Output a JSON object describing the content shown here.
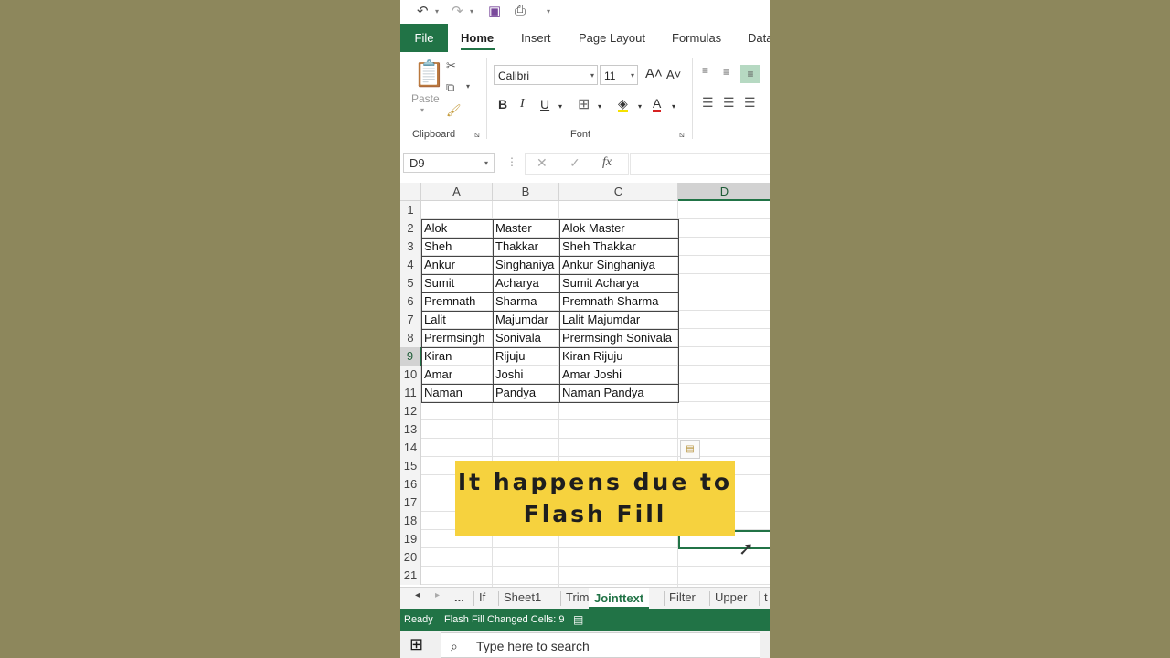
{
  "qat": {
    "more": "▾"
  },
  "tabs": {
    "file": "File",
    "home": "Home",
    "insert": "Insert",
    "page_layout": "Page Layout",
    "formulas": "Formulas",
    "data": "Data"
  },
  "ribbon": {
    "clipboard_label": "Clipboard",
    "paste_label": "Paste",
    "font_label": "Font",
    "font_name": "Calibri",
    "font_size": "11",
    "bold": "B",
    "italic": "I",
    "underline": "U"
  },
  "formula_bar": {
    "name_box": "D9",
    "fx": "fx",
    "formula": ""
  },
  "grid": {
    "columns": [
      "A",
      "B",
      "C",
      "D"
    ],
    "selected_column": "D",
    "row_numbers": [
      "1",
      "2",
      "3",
      "4",
      "5",
      "6",
      "7",
      "8",
      "9",
      "10",
      "11",
      "12",
      "13",
      "14",
      "15",
      "16",
      "17",
      "18",
      "19",
      "20",
      "21"
    ],
    "selected_row": "9",
    "rows": [
      [
        "Alok",
        "Master",
        "Alok Master"
      ],
      [
        "Sheh",
        "Thakkar",
        "Sheh Thakkar"
      ],
      [
        "Ankur",
        "Singhaniya",
        "Ankur Singhaniya"
      ],
      [
        "Sumit",
        "Acharya",
        "Sumit Acharya"
      ],
      [
        "Premnath",
        "Sharma",
        "Premnath Sharma"
      ],
      [
        "Lalit",
        "Majumdar",
        "Lalit Majumdar"
      ],
      [
        "Prermsingh",
        "Sonivala",
        "Prermsingh Sonivala"
      ],
      [
        "Kiran",
        "Rijuju",
        "Kiran Rijuju"
      ],
      [
        "Amar",
        "Joshi",
        "Amar Joshi"
      ],
      [
        "Naman",
        "Pandya",
        "Naman Pandya"
      ]
    ]
  },
  "caption": {
    "line1": "It happens due to",
    "line2": "Flash Fill"
  },
  "sheet_tabs": {
    "ellipsis": "...",
    "tabs": [
      "If",
      "Sheet1",
      "Trim",
      "Jointtext",
      "Filter",
      "Upper",
      "t"
    ],
    "active": "Jointtext"
  },
  "status": {
    "ready": "Ready",
    "message": "Flash Fill Changed Cells: 9"
  },
  "taskbar": {
    "search_placeholder": "Type here to search"
  },
  "colors": {
    "excel_green": "#217346",
    "caption_yellow": "#f6d23e",
    "background": "#8b8459"
  }
}
